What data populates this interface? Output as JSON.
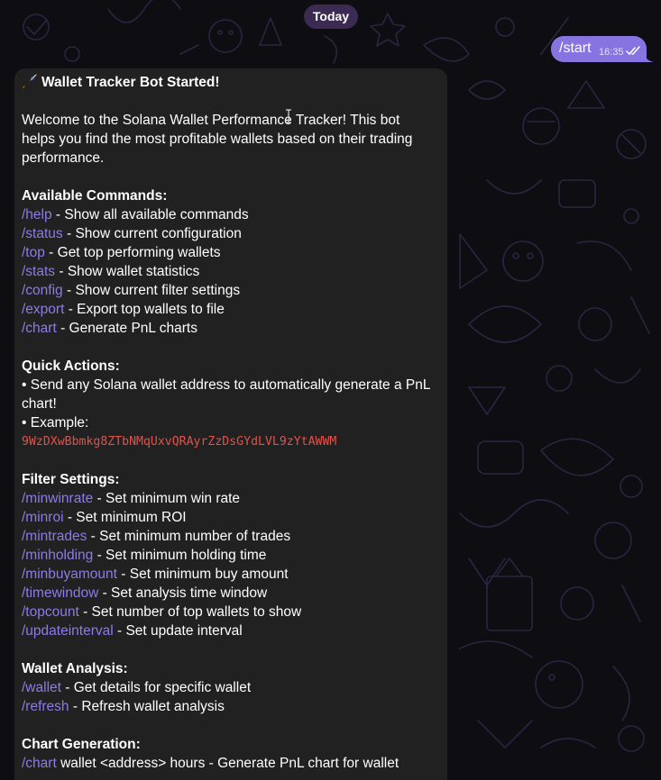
{
  "chat": {
    "date_label": "Today",
    "outgoing": {
      "text": "/start",
      "time": "16:35",
      "status_icon": "double-check-icon"
    },
    "incoming": {
      "title_icon": "rocket-icon",
      "title": "Wallet Tracker Bot Started!",
      "intro_1": "Welcome to the Solana Wallet Performance Tracker! This bot",
      "intro_2": "helps you find the most profitable wallets based on their trading",
      "intro_3": "performance.",
      "sections": {
        "commands": {
          "heading": "Available Commands:",
          "items": [
            {
              "cmd": "/help",
              "desc": " - Show all available commands"
            },
            {
              "cmd": "/status",
              "desc": " - Show current configuration"
            },
            {
              "cmd": "/top",
              "desc": " - Get top performing wallets"
            },
            {
              "cmd": "/stats",
              "desc": " - Show wallet statistics"
            },
            {
              "cmd": "/config",
              "desc": " - Show current filter settings"
            },
            {
              "cmd": "/export",
              "desc": " - Export top wallets to file"
            },
            {
              "cmd": "/chart",
              "desc": " - Generate PnL charts"
            }
          ]
        },
        "quick": {
          "heading": "Quick Actions:",
          "line_1": "• Send any Solana wallet address to automatically generate a PnL",
          "line_2": "chart!",
          "line_3": "• Example:",
          "address": "9WzDXwBbmkg8ZTbNMqUxvQRAyrZzDsGYdLVL9zYtAWWM"
        },
        "filters": {
          "heading": "Filter Settings:",
          "items": [
            {
              "cmd": "/minwinrate",
              "desc": " - Set minimum win rate"
            },
            {
              "cmd": "/minroi",
              "desc": " - Set minimum ROI"
            },
            {
              "cmd": "/mintrades",
              "desc": " - Set minimum number of trades"
            },
            {
              "cmd": "/minholding",
              "desc": " - Set minimum holding time"
            },
            {
              "cmd": "/minbuyamount",
              "desc": " - Set minimum buy amount"
            },
            {
              "cmd": "/timewindow",
              "desc": " - Set analysis time window"
            },
            {
              "cmd": "/topcount",
              "desc": " - Set number of top wallets to show"
            },
            {
              "cmd": "/updateinterval",
              "desc": " - Set update interval"
            }
          ]
        },
        "wallet": {
          "heading": "Wallet Analysis:",
          "items": [
            {
              "cmd": "/wallet",
              "desc": " - Get details for specific wallet"
            },
            {
              "cmd": "/refresh",
              "desc": " - Refresh wallet analysis"
            }
          ]
        },
        "chart": {
          "heading": "Chart Generation:",
          "items": [
            {
              "cmd": "/chart",
              "desc": " wallet <address> hours - Generate PnL chart for wallet"
            }
          ]
        }
      }
    }
  },
  "colors": {
    "background": "#0e0d12",
    "outgoing_bubble": "#8774e1",
    "incoming_bubble": "#212121",
    "command_link": "#8c7ce6",
    "code": "#e0534b",
    "date_pill": "#3b2a52"
  }
}
